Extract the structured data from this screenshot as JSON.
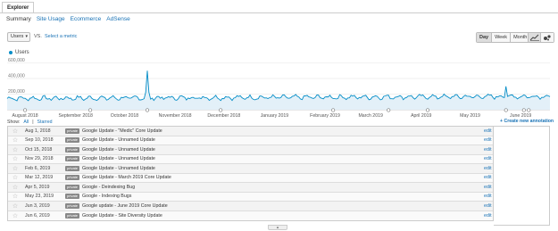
{
  "header": {
    "explorer_tab": "Explorer"
  },
  "subtabs": [
    {
      "label": "Summary",
      "active": true
    },
    {
      "label": "Site Usage",
      "active": false
    },
    {
      "label": "Ecommerce",
      "active": false
    },
    {
      "label": "AdSense",
      "active": false
    }
  ],
  "controls": {
    "metric": "Users",
    "vs": "VS.",
    "select_metric": "Select a metric",
    "periods": [
      {
        "label": "Day",
        "active": true
      },
      {
        "label": "Week",
        "active": false
      },
      {
        "label": "Month",
        "active": false
      }
    ],
    "chart_type_icons": [
      "line-chart-icon",
      "motion-chart-icon"
    ]
  },
  "legend": {
    "label": "Users",
    "color": "#058dc7"
  },
  "chart_data": {
    "type": "area",
    "series": [
      {
        "name": "Users",
        "color": "#058dc7"
      }
    ],
    "yticks": [
      "600,000",
      "400,000",
      "200,000"
    ],
    "ytick_values": [
      600000,
      400000,
      200000
    ],
    "ylim": [
      0,
      630000
    ],
    "xlabels": [
      "August 2018",
      "September 2018",
      "October 2018",
      "November 2018",
      "December 2018",
      "January 2019",
      "February 2019",
      "March 2019",
      "April 2019",
      "May 2019",
      "June 2019"
    ],
    "x_start": "2018-07-21",
    "x_end": "2019-06-19",
    "peaks": [
      {
        "date": "2018-10-15",
        "value": 500000
      },
      {
        "date": "2019-05-23",
        "value": 300000
      }
    ],
    "baseline_value": 145000,
    "annotation_markers": 10
  },
  "annotations_bar": {
    "show_label": "Show:",
    "all": "All",
    "separator": "|",
    "starred": "Starred",
    "create": "+ Create new annotation"
  },
  "annotations": [
    {
      "date": "Aug 1, 2018",
      "badge": "private",
      "text": "Google Update - \"Medic\" Core Update",
      "action": "edit"
    },
    {
      "date": "Sep 10, 2018",
      "badge": "private",
      "text": "Google Update - Unnamed Update",
      "action": "edit"
    },
    {
      "date": "Oct 15, 2018",
      "badge": "private",
      "text": "Google Update - Unnamed Update",
      "action": "edit"
    },
    {
      "date": "Nov 29, 2018",
      "badge": "private",
      "text": "Google Update - Unnamed Update",
      "action": "edit"
    },
    {
      "date": "Feb 6, 2019",
      "badge": "private",
      "text": "Google Update - Unnamed Update",
      "action": "edit"
    },
    {
      "date": "Mar 12, 2019",
      "badge": "private",
      "text": "Google Update - March 2019 Core Update",
      "action": "edit"
    },
    {
      "date": "Apr 5, 2019",
      "badge": "private",
      "text": "Google - Deindexing Bug",
      "action": "edit"
    },
    {
      "date": "May 23, 2019",
      "badge": "private",
      "text": "Google - Indexing Bugs",
      "action": "edit"
    },
    {
      "date": "Jun 3, 2019",
      "badge": "private",
      "text": "Google update - June 2019 Core Update",
      "action": "edit"
    },
    {
      "date": "Jun 6, 2019",
      "badge": "private",
      "text": "Google Update - Site Diversity Update",
      "action": "edit"
    }
  ],
  "collapse_icon": "collapse-arrow-icon"
}
